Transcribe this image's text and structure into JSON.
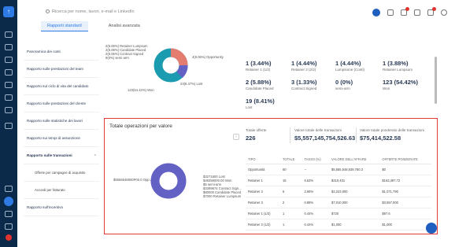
{
  "header": {
    "search_placeholder": "Ricerca per nome, lavori, e-mail e LinkedIn",
    "tabs": [
      {
        "label": "Rapporti standard"
      },
      {
        "label": "Analisi avanzata"
      }
    ]
  },
  "menu": {
    "items": [
      {
        "label": "Panoramica dei costi"
      },
      {
        "label": "Rapporto sulle prestazioni del team"
      },
      {
        "label": "Rapporto sul ciclo di vita del candidato"
      },
      {
        "label": "Rapporto sulle prestazioni del cliente"
      },
      {
        "label": "Rapporto sulle statistiche dei lavori"
      },
      {
        "label": "Rapporto sui tempi di assunzione"
      },
      {
        "label": "Rapporto sulle transazioni"
      },
      {
        "label": "Offerte per campagne di acquisito"
      },
      {
        "label": "Accordi per fatturato"
      },
      {
        "label": "Rapporto sull'incentivo"
      }
    ]
  },
  "top_panel": {
    "pie_labels": [
      "2(6.06%) Retainer Lumpsum",
      "2(6.06%) Candidate Placed",
      "2(6.06%) Contract Signed",
      "9(0%) semi-arm"
    ],
    "pie_label_right_1": "4(6.06%) Opportunity",
    "pie_label_right_2": "23(6.47%) Lost",
    "pie_label_bottom": "123(54.42%) Won",
    "kpis": [
      {
        "value": "1 (3.44%)",
        "sub": "Retainer 1 (1/2)"
      },
      {
        "value": "1 (4.44%)",
        "sub": "Retainer 2 (2/2)"
      },
      {
        "value": "1 (4.44%)",
        "sub": "Lumpsome (Conti)"
      },
      {
        "value": "1 (3.88%)",
        "sub": "Retainer Lumpsum"
      },
      {
        "value": "2 (5.88%)",
        "sub": "Candidate Placed"
      },
      {
        "value": "3 (1.33%)",
        "sub": "Contract Signed"
      },
      {
        "value": "0 (0%)",
        "sub": "semi-arm"
      },
      {
        "value": "123 (54.42%)",
        "sub": "Won"
      },
      {
        "value": "19 (8.41%)",
        "sub": "Lost"
      }
    ]
  },
  "section": {
    "title": "Totale operazioni per valore",
    "stats": [
      {
        "label": "Totale offerte",
        "value": "226"
      },
      {
        "label": "Valore totale delle transazioni",
        "value": "$5,557,145,754,526.63"
      },
      {
        "label": "Valore totale ponderato delle transazioni",
        "value": "$75,414,522.58"
      }
    ],
    "pie_label_left": "$5555548800P00.0 Opp...",
    "pie_labels_right": [
      "$3271900 Lost",
      "$48359000.00 Won",
      "$5 semi-arm",
      "$3399674 Contract Sign...",
      "$80000 Candidate Placed",
      "$7000 Retainer Lumpsum"
    ],
    "chart_colors": [
      "#6461c5",
      "#1a9bb0",
      "#2c6fd2",
      "#e7c94a"
    ],
    "table": {
      "columns": [
        "TIPO",
        "TOTALE",
        "TASSO (%)",
        "VALORE DELL'AFFARE",
        "OFFERTE PONDERATE"
      ],
      "rows": [
        [
          "Opportunità",
          "60",
          "--",
          "$5,555,548,839,780.3",
          "$0"
        ],
        [
          "Retainer 1",
          "15",
          "6.63%",
          "$410,401",
          "$163,387.72"
        ],
        [
          "Retainer 2",
          "6",
          "2.65%",
          "$2,223,000",
          "$1,071,790"
        ],
        [
          "Retainer 3",
          "2",
          "0.88%",
          "$7,010,000",
          "$3,557,000"
        ],
        [
          "Retainer 1 (1/2)",
          "1",
          "0.44%",
          "$720",
          "$97.6"
        ],
        [
          "Retainer 2 (1/2)",
          "1",
          "0.44%",
          "$1,000",
          "$1,000"
        ]
      ]
    }
  }
}
